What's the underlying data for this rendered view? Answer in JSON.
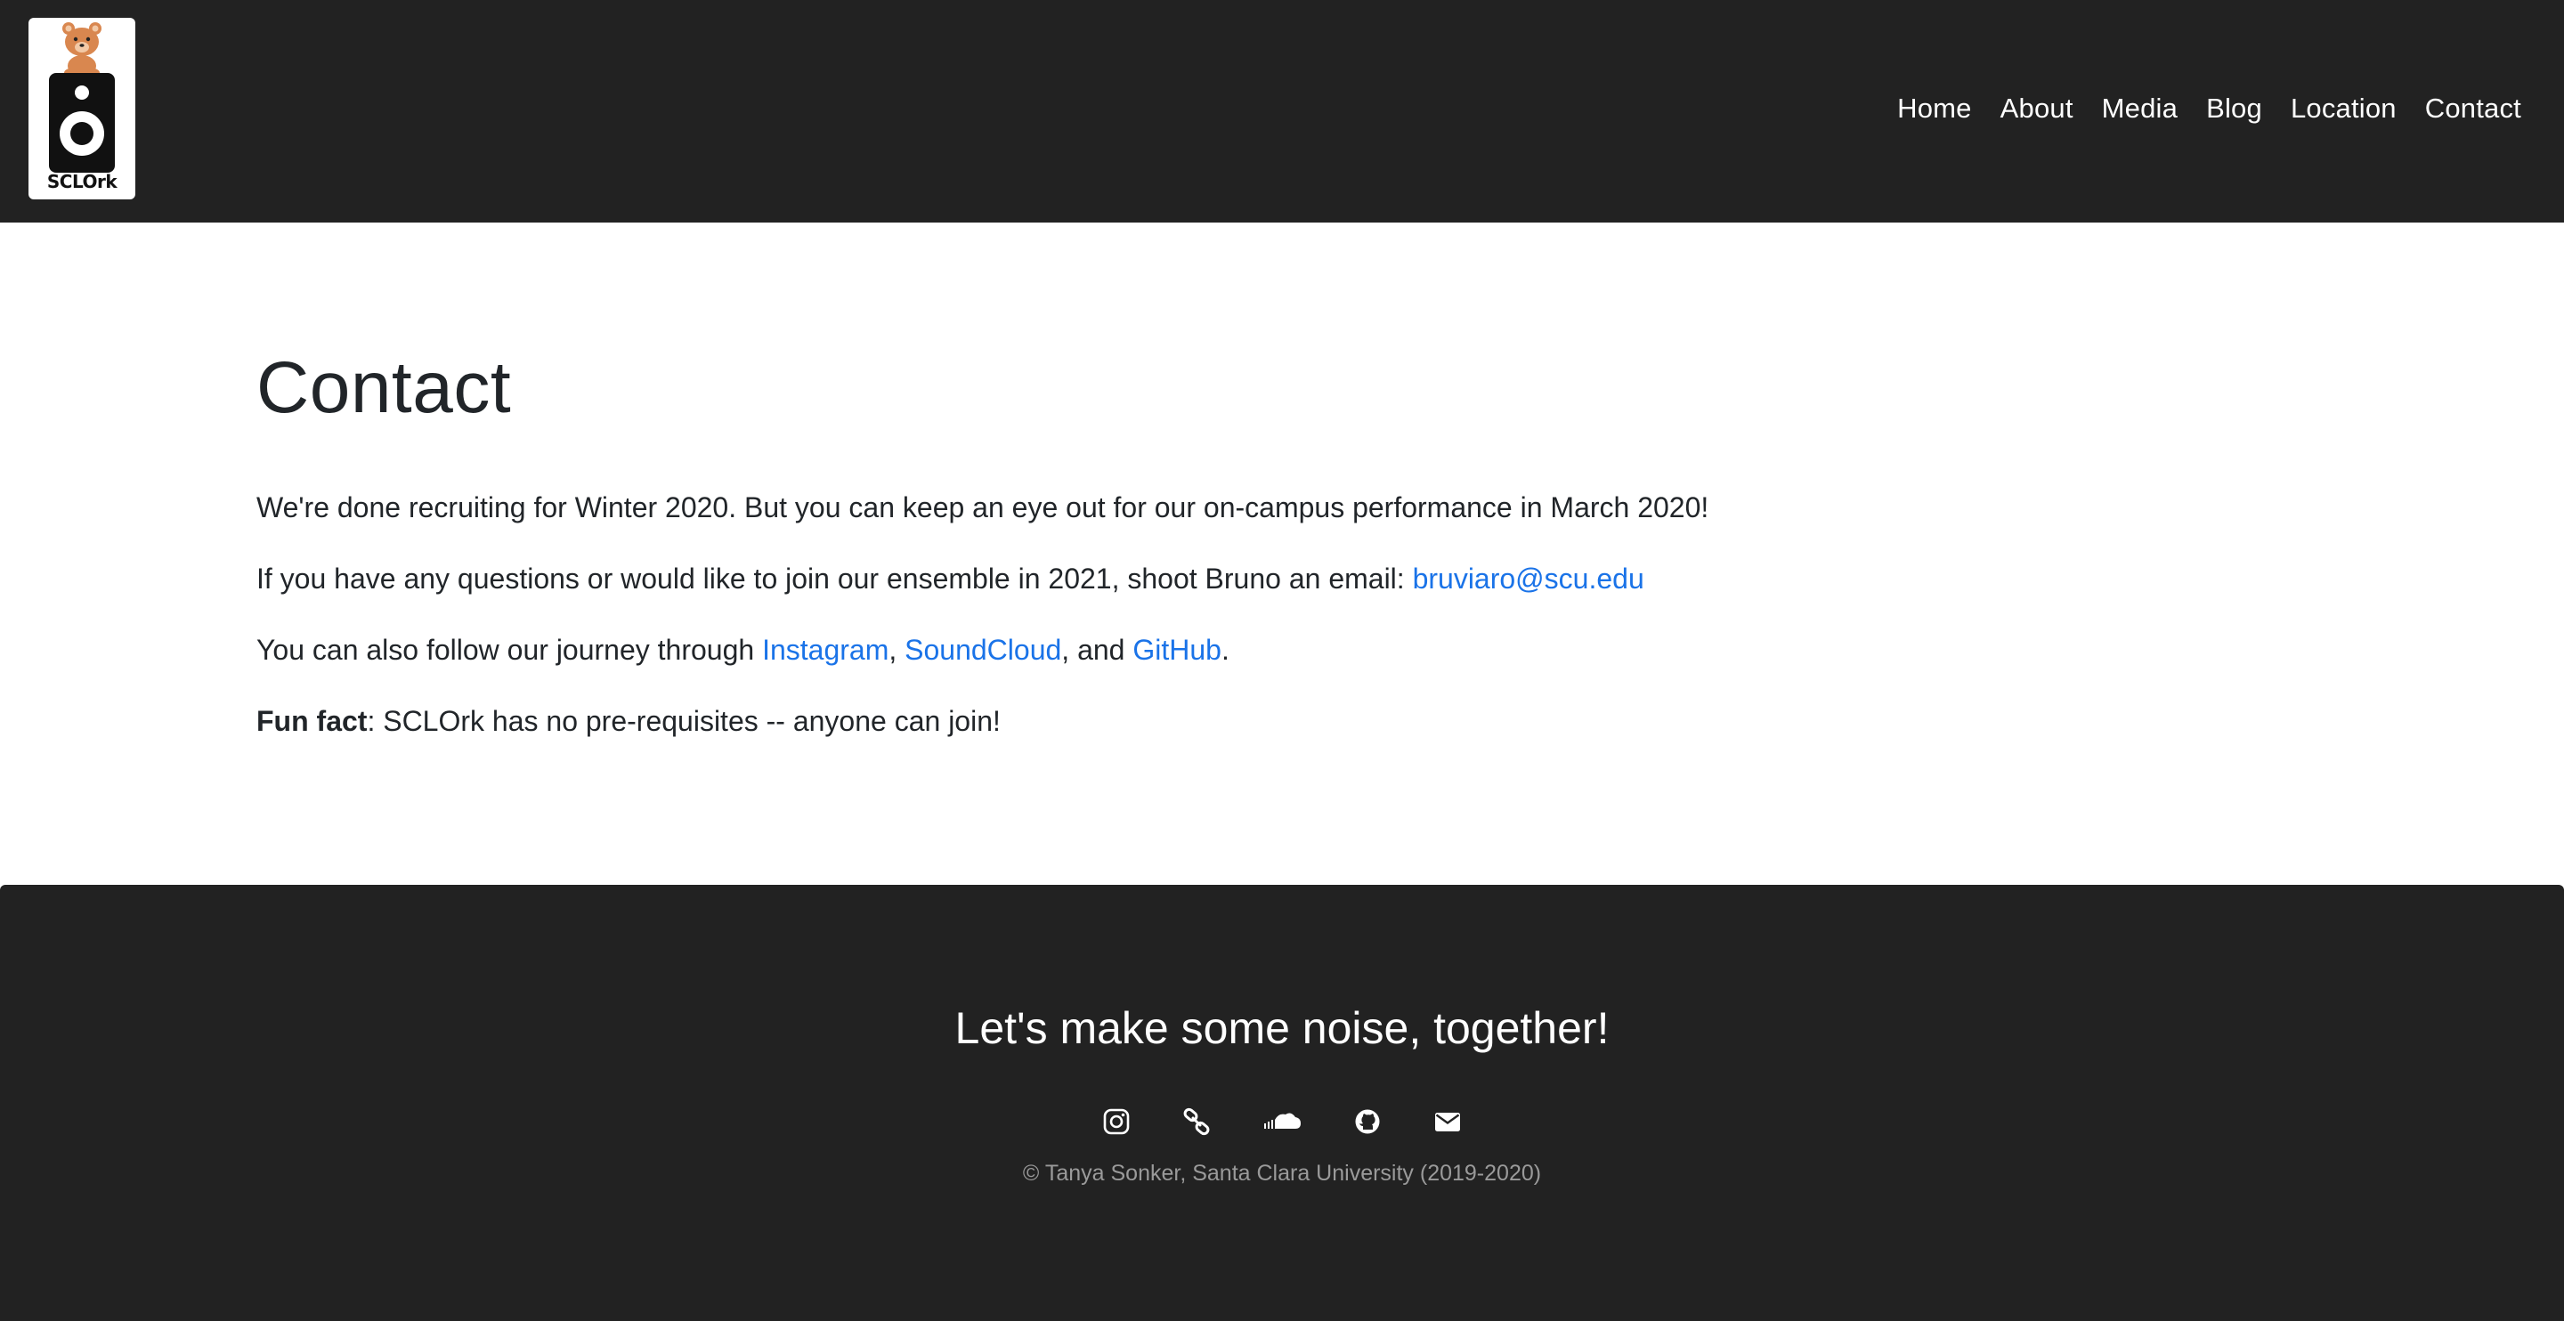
{
  "header": {
    "logo_text": "SCLOrk",
    "nav": [
      {
        "label": "Home"
      },
      {
        "label": "About"
      },
      {
        "label": "Media"
      },
      {
        "label": "Blog"
      },
      {
        "label": "Location"
      },
      {
        "label": "Contact"
      }
    ]
  },
  "main": {
    "title": "Contact",
    "p1": "We're done recruiting for Winter 2020. But you can keep an eye out for our on-campus performance in March 2020!",
    "p2_text": "If you have any questions or would like to join our ensemble in 2021, shoot Bruno an email: ",
    "p2_email": "bruviaro@scu.edu",
    "p3_text": "You can also follow our journey through ",
    "p3_link1": "Instagram",
    "p3_sep1": ", ",
    "p3_link2": "SoundCloud",
    "p3_sep2": ", and ",
    "p3_link3": "GitHub",
    "p3_end": ".",
    "p4_bold": "Fun fact",
    "p4_text": ": SCLOrk has no pre-requisites -- anyone can join!"
  },
  "footer": {
    "tagline": "Let's make some noise, together!",
    "social_icons": [
      "instagram-icon",
      "link-icon",
      "soundcloud-icon",
      "github-icon",
      "envelope-icon"
    ],
    "copyright": "© Tanya Sonker, Santa Clara University (2019-2020)"
  },
  "colors": {
    "header_bg": "#222222",
    "footer_bg": "#222222",
    "link": "#1a73e8",
    "text": "#212529",
    "copyright": "#9a9a9a"
  }
}
